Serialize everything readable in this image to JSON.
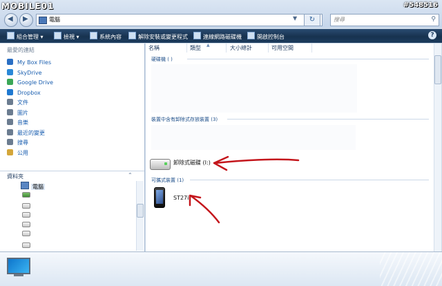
{
  "branding": {
    "logo": "MOBILE01",
    "post_id": "#548516"
  },
  "address_bar": {
    "path": "電腦",
    "search_placeholder": "搜尋"
  },
  "command_bar": {
    "items": [
      "組合管理",
      "檢視",
      "系統內容",
      "解除安裝或變更程式",
      "連線網路磁碟機",
      "開啟控制台"
    ]
  },
  "sidebar": {
    "favorites_title": "最愛的連結",
    "favorites": [
      {
        "label": "My Box Files",
        "color": "#2a6fc4"
      },
      {
        "label": "SkyDrive",
        "color": "#2a88d8"
      },
      {
        "label": "Google Drive",
        "color": "#3aa757"
      },
      {
        "label": "Dropbox",
        "color": "#1f79d1"
      },
      {
        "label": "文件",
        "color": "#6b7c90"
      },
      {
        "label": "圖片",
        "color": "#6b7c90"
      },
      {
        "label": "音樂",
        "color": "#6b7c90"
      },
      {
        "label": "最近的變更",
        "color": "#6b7c90"
      },
      {
        "label": "搜尋",
        "color": "#6b7c90"
      },
      {
        "label": "公用",
        "color": "#d4a63a"
      }
    ],
    "folders_title": "資料夾",
    "tree_selected": "電腦"
  },
  "columns": [
    "名稱",
    "類型",
    "大小總計",
    "可用空間"
  ],
  "groups": {
    "hard_drives": "硬碟機 ( )",
    "removable": "裝置中含有卸除式存放裝置 (3)",
    "portable": "可攜式裝置 (1)"
  },
  "items": {
    "removable_disk": "卸除式磁碟 (I:)",
    "phone": "ST27i"
  },
  "accent_colors": {
    "annotation": "#c4161c",
    "commandbar": "#1d3d5f"
  }
}
